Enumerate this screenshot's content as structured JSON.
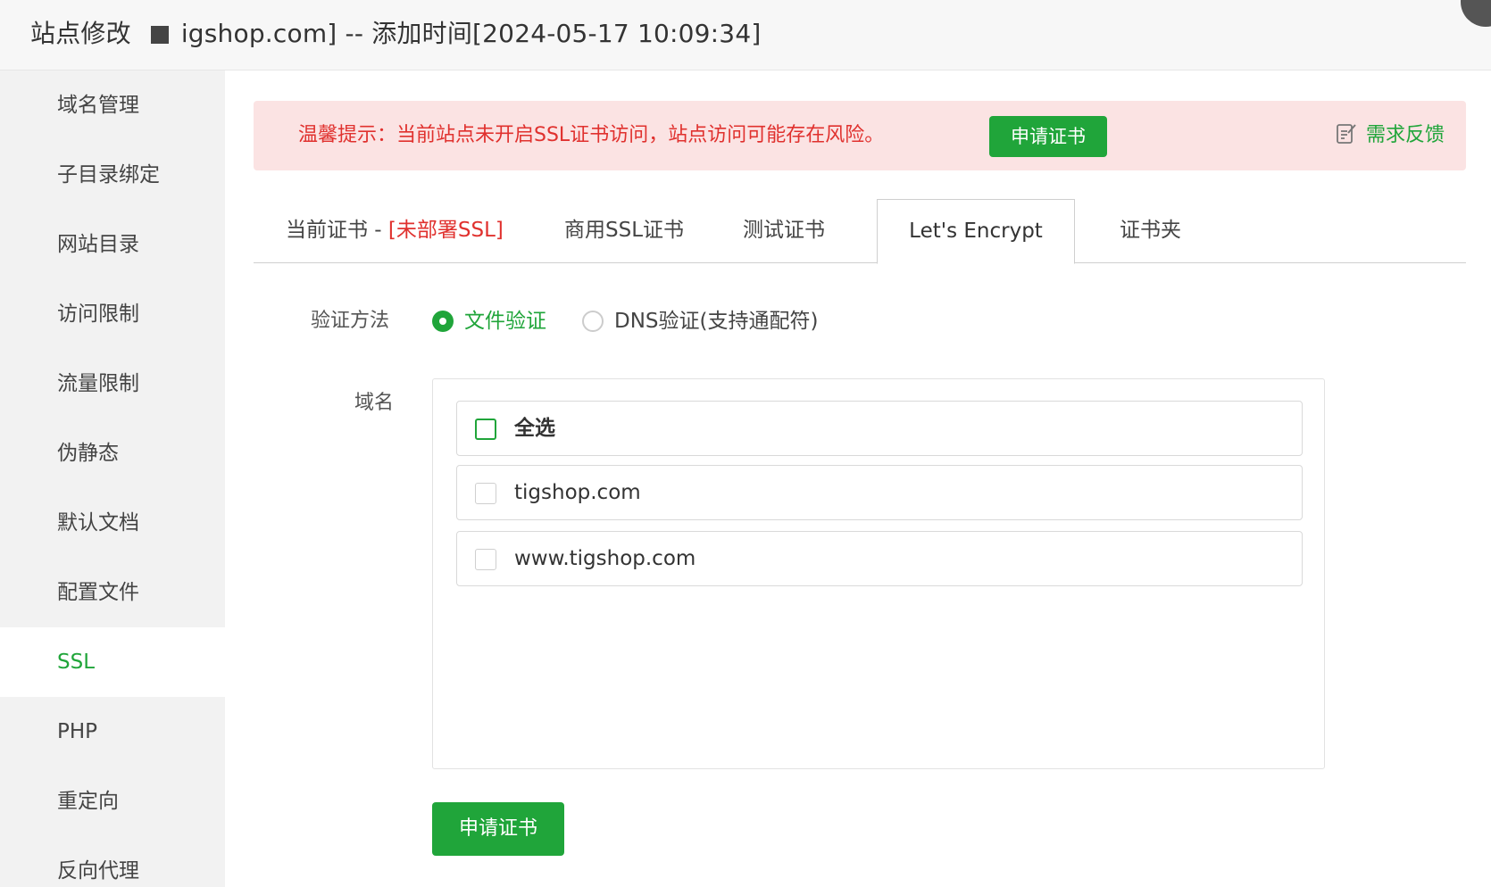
{
  "window": {
    "title_prefix": "站点修改",
    "title_suffix": "igshop.com] -- 添加时间[2024-05-17 10:09:34]"
  },
  "sidebar": {
    "items": [
      {
        "label": "域名管理"
      },
      {
        "label": "子目录绑定"
      },
      {
        "label": "网站目录"
      },
      {
        "label": "访问限制"
      },
      {
        "label": "流量限制"
      },
      {
        "label": "伪静态"
      },
      {
        "label": "默认文档"
      },
      {
        "label": "配置文件"
      },
      {
        "label": "SSL"
      },
      {
        "label": "PHP"
      },
      {
        "label": "重定向"
      },
      {
        "label": "反向代理"
      }
    ],
    "active": "SSL"
  },
  "notice": {
    "text": "温馨提示：当前站点未开启SSL证书访问，站点访问可能存在风险。",
    "button": "申请证书",
    "feedback": "需求反馈"
  },
  "tabs": [
    {
      "label": "当前证书 - ",
      "status": "[未部署SSL]"
    },
    {
      "label": "商用SSL证书"
    },
    {
      "label": "测试证书"
    },
    {
      "label": "Let's Encrypt"
    },
    {
      "label": "证书夹"
    }
  ],
  "active_tab": "Let's Encrypt",
  "form": {
    "verify_label": "验证方法",
    "verify_options": [
      {
        "label": "文件验证",
        "checked": true
      },
      {
        "label": "DNS验证(支持通配符)",
        "checked": false
      }
    ],
    "domain_label": "域名",
    "domains": [
      {
        "label": "全选",
        "checked": false
      },
      {
        "label": "tigshop.com",
        "checked": false
      },
      {
        "label": "www.tigshop.com",
        "checked": false
      }
    ],
    "submit": "申请证书"
  },
  "colors": {
    "accent": "#20a53a",
    "warning": "#e0312e",
    "notice_bg": "#fbe3e3"
  }
}
